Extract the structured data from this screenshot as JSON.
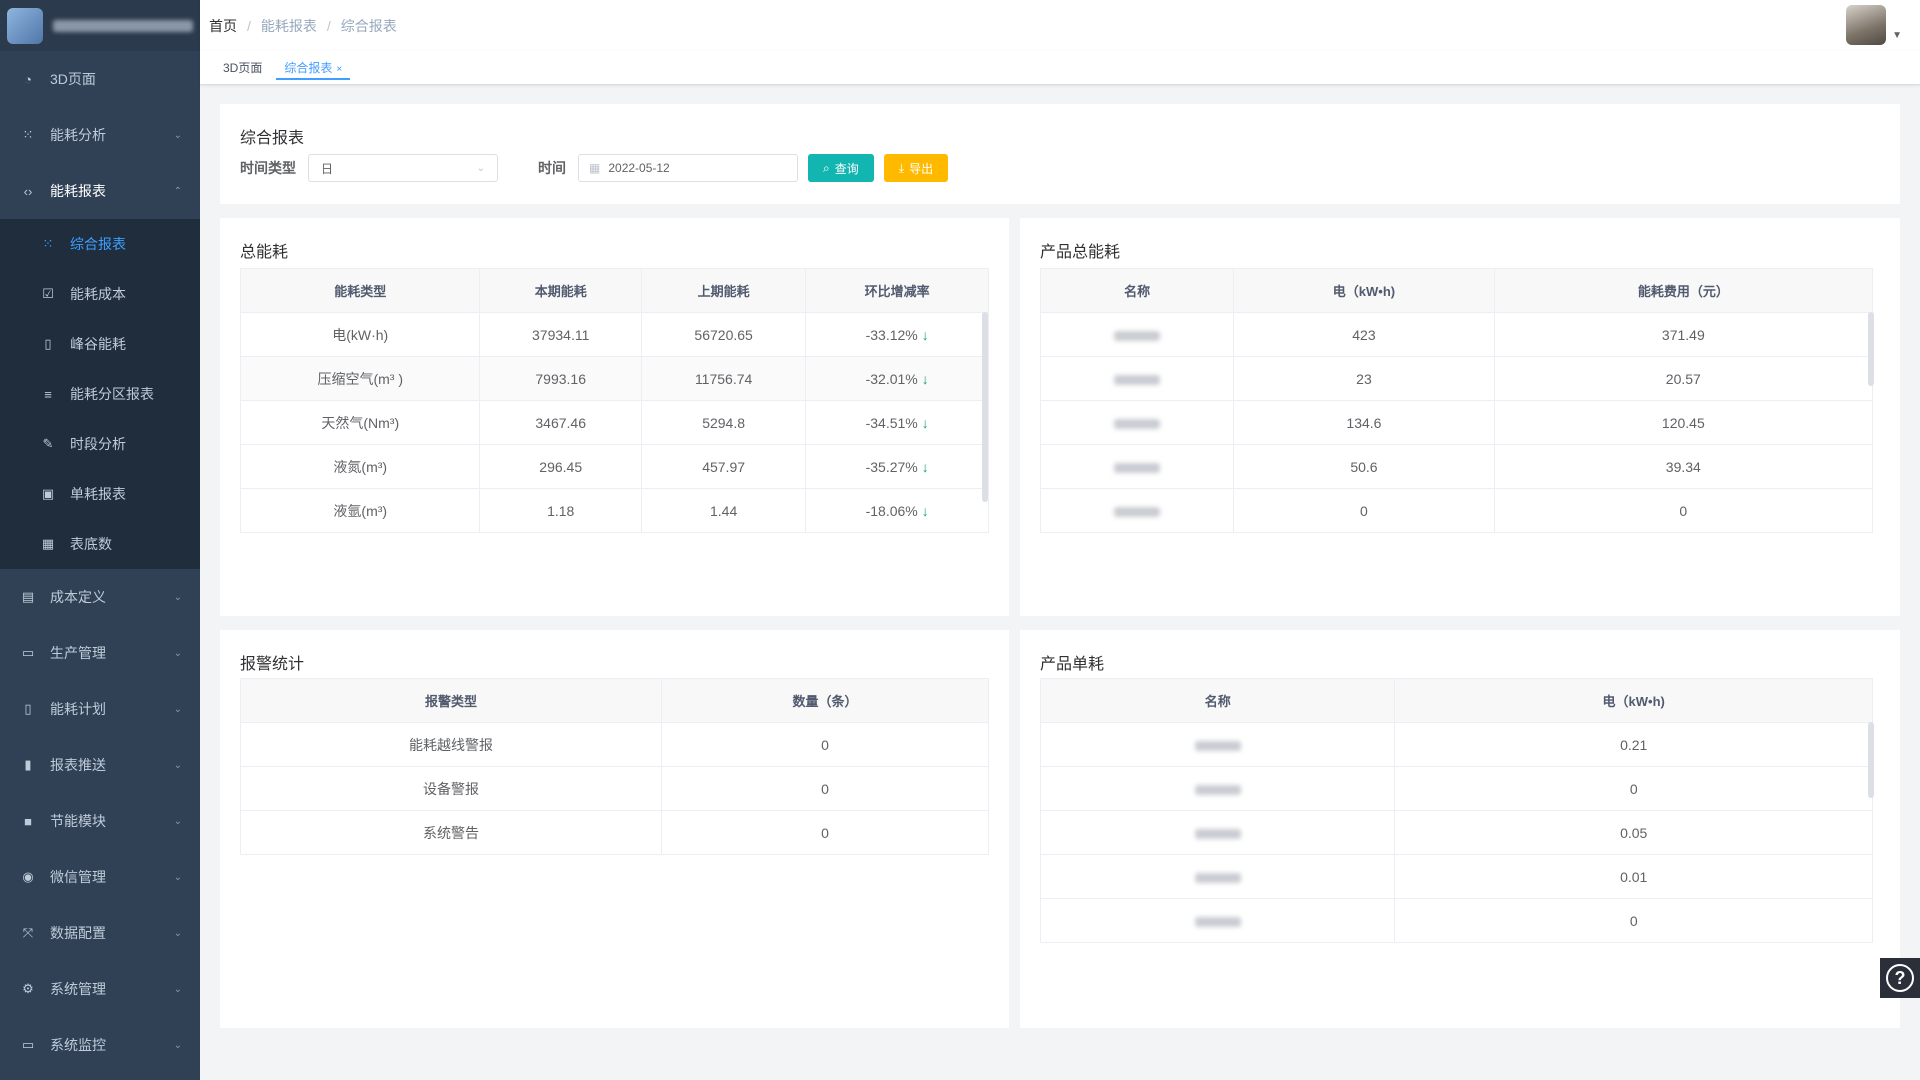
{
  "breadcrumb": [
    "首页",
    "能耗报表",
    "综合报表"
  ],
  "tags": [
    {
      "label": "3D页面",
      "active": false
    },
    {
      "label": "综合报表",
      "active": true,
      "close": "×"
    }
  ],
  "sidebar": {
    "items": [
      {
        "label": "3D页面",
        "icon": "dashboard-icon",
        "glyph": "◔"
      },
      {
        "label": "能耗分析",
        "icon": "grid-dots-icon",
        "glyph": "⁙",
        "chev": "⌄"
      },
      {
        "label": "能耗报表",
        "icon": "code-icon",
        "glyph": "‹›",
        "chev": "⌃"
      },
      {
        "label": "成本定义",
        "icon": "document-icon",
        "glyph": "▤",
        "chev": "⌄"
      },
      {
        "label": "生产管理",
        "icon": "monitor-icon",
        "glyph": "▭",
        "chev": "⌄"
      },
      {
        "label": "能耗计划",
        "icon": "clipboard-icon",
        "glyph": "▯",
        "chev": "⌄"
      },
      {
        "label": "报表推送",
        "icon": "phone-icon",
        "glyph": "▮",
        "chev": "⌄"
      },
      {
        "label": "节能模块",
        "icon": "lock-icon",
        "glyph": "■",
        "chev": "⌄"
      },
      {
        "label": "微信管理",
        "icon": "wechat-icon",
        "glyph": "◉",
        "chev": "⌄"
      },
      {
        "label": "数据配置",
        "icon": "fullscreen-icon",
        "glyph": "⤧",
        "chev": "⌄"
      },
      {
        "label": "系统管理",
        "icon": "gear-icon",
        "glyph": "⚙",
        "chev": "⌄"
      },
      {
        "label": "系统监控",
        "icon": "monitor-icon",
        "glyph": "▭",
        "chev": "⌄"
      }
    ],
    "sub_items": [
      {
        "label": "综合报表",
        "icon": "grid-dots-icon",
        "glyph": "⁙",
        "active": true
      },
      {
        "label": "能耗成本",
        "icon": "checkbox-icon",
        "glyph": "☑"
      },
      {
        "label": "峰谷能耗",
        "icon": "clipboard-icon",
        "glyph": "▯"
      },
      {
        "label": "能耗分区报表",
        "icon": "list-icon",
        "glyph": "≡"
      },
      {
        "label": "时段分析",
        "icon": "edit-icon",
        "glyph": "✎"
      },
      {
        "label": "单耗报表",
        "icon": "briefcase-icon",
        "glyph": "▣"
      },
      {
        "label": "表底数",
        "icon": "table-icon",
        "glyph": "▦"
      }
    ]
  },
  "filter": {
    "title": "综合报表",
    "time_type_label": "时间类型",
    "time_type_value": "日",
    "time_label": "时间",
    "date_value": "2022-05-12",
    "query_label": "查询",
    "export_label": "导出",
    "query_color": "#13b5b1",
    "export_color": "#ffba00"
  },
  "total_energy": {
    "title": "总能耗",
    "columns": [
      "能耗类型",
      "本期能耗",
      "上期能耗",
      "环比增减率"
    ],
    "rows": [
      [
        "电(kW·h)",
        "37934.11",
        "56720.65",
        "-33.12%"
      ],
      [
        "压缩空气(m³ )",
        "7993.16",
        "11756.74",
        "-32.01%"
      ],
      [
        "天然气(Nm³)",
        "3467.46",
        "5294.8",
        "-34.51%"
      ],
      [
        "液氮(m³)",
        "296.45",
        "457.97",
        "-35.27%"
      ],
      [
        "液氩(m³)",
        "1.18",
        "1.44",
        "-18.06%"
      ]
    ],
    "trend_glyph": "↓",
    "trend_color": "#13a46b"
  },
  "product_total": {
    "title": "产品总能耗",
    "columns": [
      "名称",
      "电（kW•h)",
      "能耗费用（元）"
    ],
    "rows": [
      [
        "",
        "423",
        "371.49"
      ],
      [
        "",
        "23",
        "20.57"
      ],
      [
        "",
        "134.6",
        "120.45"
      ],
      [
        "",
        "50.6",
        "39.34"
      ],
      [
        "",
        "0",
        "0"
      ]
    ]
  },
  "alarm_stats": {
    "title": "报警统计",
    "columns": [
      "报警类型",
      "数量（条）"
    ],
    "rows": [
      [
        "能耗越线警报",
        "0"
      ],
      [
        "设备警报",
        "0"
      ],
      [
        "系统警告",
        "0"
      ]
    ]
  },
  "product_unit": {
    "title": "产品单耗",
    "columns": [
      "名称",
      "电（kW•h)"
    ],
    "rows": [
      [
        "",
        "0.21"
      ],
      [
        "",
        "0"
      ],
      [
        "",
        "0.05"
      ],
      [
        "",
        "0.01"
      ],
      [
        "",
        "0"
      ]
    ]
  },
  "help_glyph": "?"
}
